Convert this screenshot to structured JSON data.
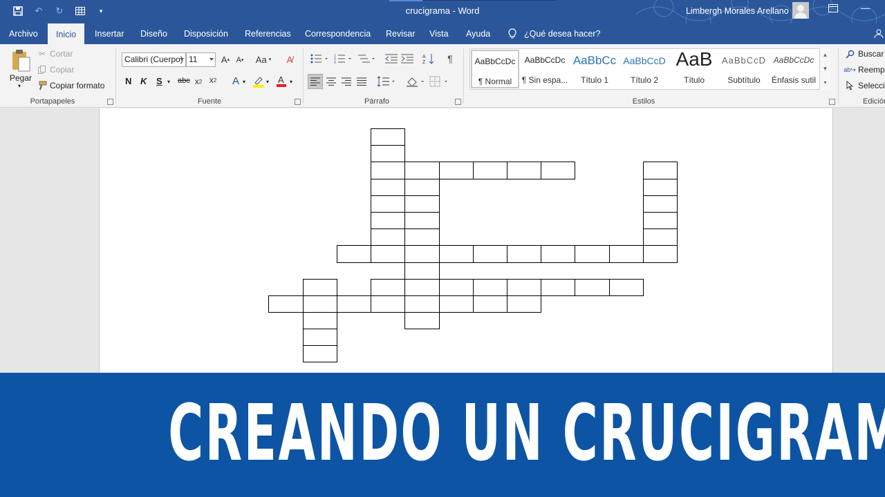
{
  "titlebar": {
    "document_title": "crucigrama  -  Word",
    "user_name": "Limbergh Morales Arellano"
  },
  "tabs": [
    {
      "label": "Archivo"
    },
    {
      "label": "Inicio"
    },
    {
      "label": "Insertar"
    },
    {
      "label": "Diseño"
    },
    {
      "label": "Disposición"
    },
    {
      "label": "Referencias"
    },
    {
      "label": "Correspondencia"
    },
    {
      "label": "Revisar"
    },
    {
      "label": "Vista"
    },
    {
      "label": "Ayuda"
    }
  ],
  "tell_me": "¿Qué desea hacer?",
  "ribbon": {
    "clipboard": {
      "paste": "Pegar",
      "cut": "Cortar",
      "copy": "Copiar",
      "format_painter": "Copiar formato",
      "label": "Portapapeles"
    },
    "font": {
      "font_name": "Calibri (Cuerpo)",
      "font_size": "11",
      "label": "Fuente",
      "bold": "N",
      "italic": "K",
      "underline": "S",
      "strike": "abc"
    },
    "paragraph": {
      "label": "Párrafo"
    },
    "styles": {
      "label": "Estilos",
      "items": [
        {
          "preview": "AaBbCcDc",
          "name": "¶ Normal"
        },
        {
          "preview": "AaBbCcDc",
          "name": "¶ Sin espa..."
        },
        {
          "preview": "AaBbCc",
          "name": "Título 1"
        },
        {
          "preview": "AaBbCcD",
          "name": "Título 2"
        },
        {
          "preview": "AaB",
          "name": "Título"
        },
        {
          "preview": "AaBbCcD",
          "name": "Subtítulo"
        },
        {
          "preview": "AaBbCcDc",
          "name": "Énfasis sutil"
        }
      ]
    },
    "editing": {
      "find": "Buscar",
      "replace": "Reemplazar",
      "select": "Seleccionar",
      "label": "Edición"
    }
  },
  "crossword": {
    "cell_count": 60
  },
  "banner": {
    "text": "CREANDO UN CRUCIGRAMA"
  }
}
